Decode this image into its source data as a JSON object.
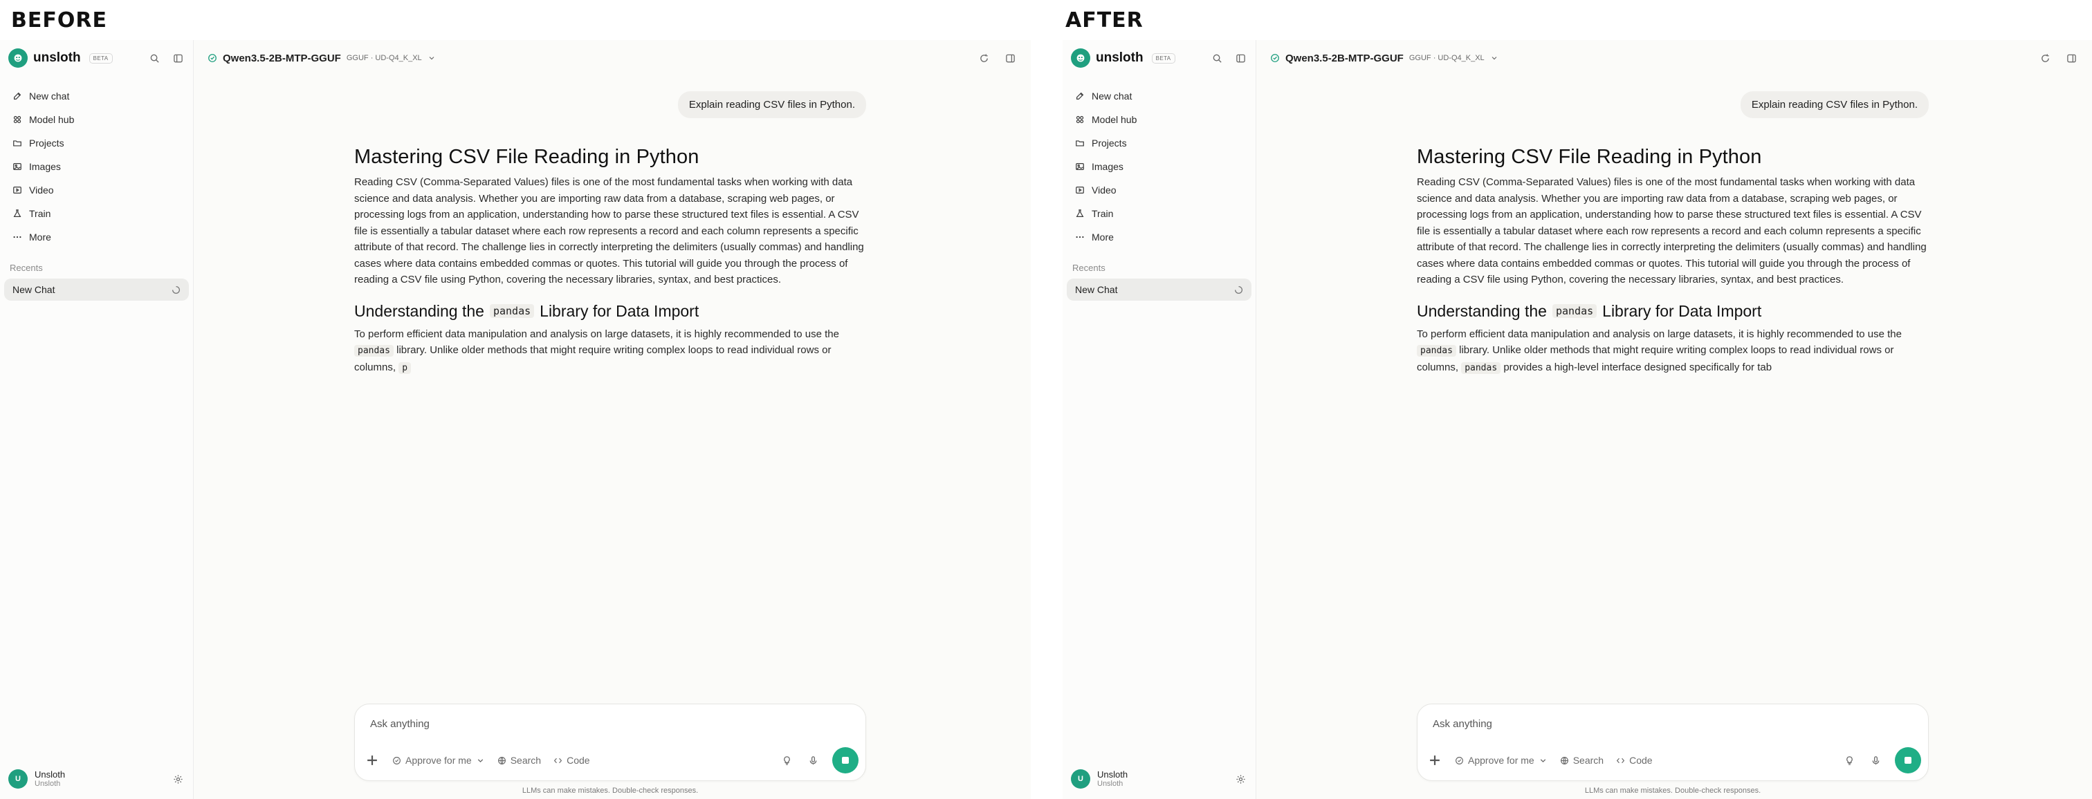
{
  "labels": {
    "before": "BEFORE",
    "after": "AFTER"
  },
  "sidebar": {
    "brand": "unsloth",
    "beta": "BETA",
    "items": [
      {
        "label": "New chat",
        "icon": "edit-icon"
      },
      {
        "label": "Model hub",
        "icon": "grid-icon"
      },
      {
        "label": "Projects",
        "icon": "folder-icon"
      },
      {
        "label": "Images",
        "icon": "image-icon"
      },
      {
        "label": "Video",
        "icon": "video-icon"
      },
      {
        "label": "Train",
        "icon": "flask-icon"
      },
      {
        "label": "More",
        "icon": "more-icon"
      }
    ],
    "recents_title": "Recents",
    "recent_item": "New Chat",
    "user_name": "Unsloth",
    "user_sub": "Unsloth",
    "user_initial": "U"
  },
  "topbar": {
    "model": "Qwen3.5-2B-MTP-GGUF",
    "tag": "GGUF · UD-Q4_K_XL"
  },
  "chat": {
    "user_message": "Explain reading CSV files in Python.",
    "title": "Mastering CSV File Reading in Python",
    "intro": "Reading CSV (Comma-Separated Values) files is one of the most fundamental tasks when working with data science and data analysis. Whether you are importing raw data from a database, scraping web pages, or processing logs from an application, understanding how to parse these structured text files is essential. A CSV file is essentially a tabular dataset where each row represents a record and each column represents a specific attribute of that record. The challenge lies in correctly interpreting the delimiters (usually commas) and handling cases where data contains embedded commas or quotes. This tutorial will guide you through the process of reading a CSV file using Python, covering the necessary libraries, syntax, and best practices.",
    "h2_pre": "Understanding the",
    "h2_code": "pandas",
    "h2_post": "Library for Data Import",
    "p2_a": "To perform efficient data manipulation and analysis on large datasets, it is highly recommended to use the",
    "p2_code": "pandas",
    "p2_b": "library. Unlike older methods that might require writing complex loops to read individual rows or columns,",
    "before_tail_code": "p",
    "after_tail_code": "pandas",
    "after_tail_text": "provides a high-level interface designed specifically for tab"
  },
  "composer": {
    "placeholder": "Ask anything",
    "approve": "Approve for me",
    "search": "Search",
    "code": "Code"
  },
  "disclaimer": "LLMs can make mistakes. Double-check responses.",
  "colors": {
    "accent": "#1fae86",
    "brand": "#1f9f7f"
  }
}
